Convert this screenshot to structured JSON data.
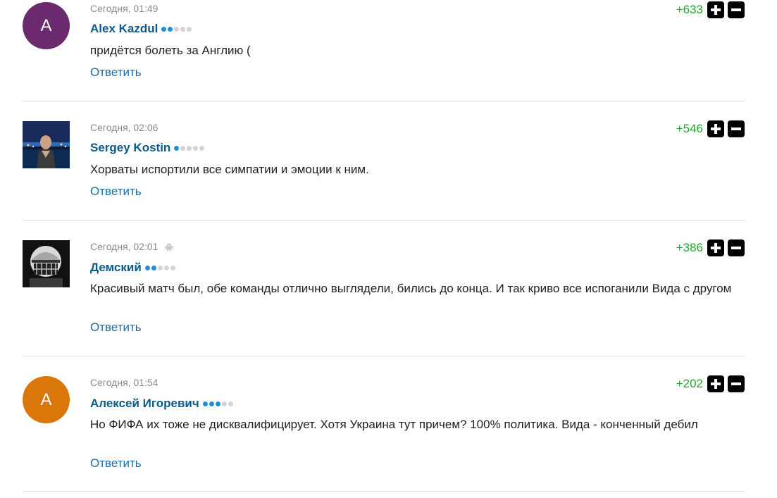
{
  "comments": [
    {
      "avatar_letter": "A",
      "avatar_color": "#6b2a6e",
      "time": "Сегодня, 01:49",
      "author": "Alex Kazdul",
      "rank_active": 2,
      "text": "придётся болеть за Англию (",
      "reply_label": "Ответить",
      "score": "+633"
    },
    {
      "avatar_letter": "",
      "avatar_color": "",
      "time": "Сегодня, 02:06",
      "author": "Sergey Kostin",
      "rank_active": 1,
      "text": "Хорваты испортили все симпатии и эмоции к ним.",
      "reply_label": "Ответить",
      "score": "+546"
    },
    {
      "avatar_letter": "",
      "avatar_color": "",
      "time": "Сегодня, 02:01",
      "device": "android-icon",
      "author": "Демский",
      "rank_active": 2,
      "text": "Красивый матч был, обе команды отлично выглядели, бились до конца. И так криво все испоганили Вида с другом",
      "reply_label": "Ответить",
      "score": "+386"
    },
    {
      "avatar_letter": "A",
      "avatar_color": "#d9770a",
      "time": "Сегодня, 01:54",
      "author": "Алексей Игоревич",
      "rank_active": 3,
      "text": "Но ФИФА их тоже не дисквалифицирует. Хотя Украина тут причем? 100% политика. Вида - конченный дебил",
      "reply_label": "Ответить",
      "score": "+202"
    }
  ],
  "colors": {
    "author": "#0b5a8c",
    "reply": "#1a6fa8",
    "score": "#1fa92b",
    "rank_on": "#1f8fd6",
    "rank_off": "#d4d4d4"
  },
  "icons": {
    "upvote": "plus-icon",
    "downvote": "minus-icon"
  }
}
